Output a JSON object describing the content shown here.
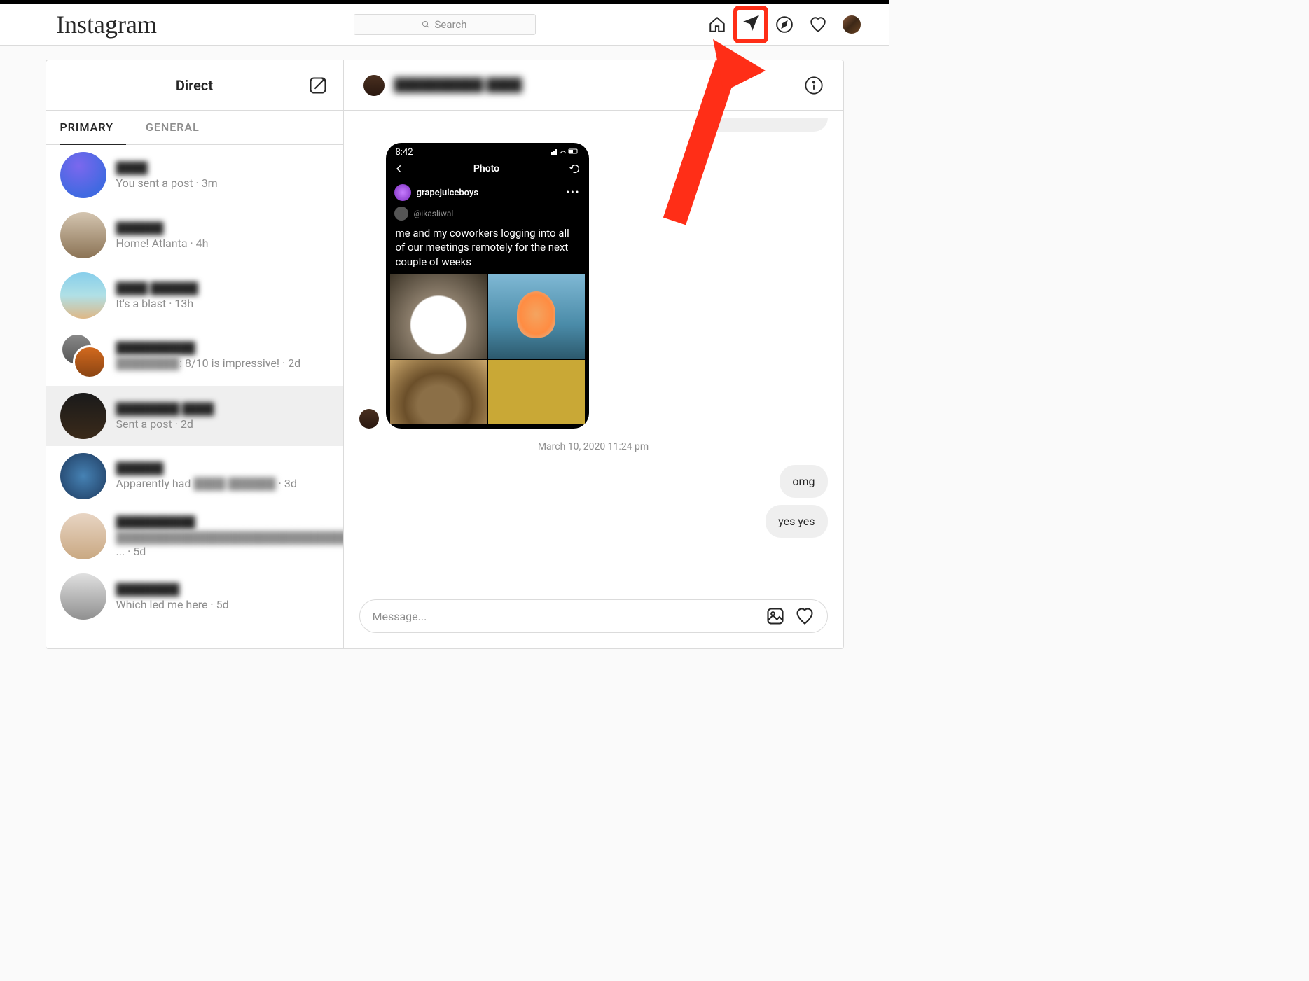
{
  "brand": "Instagram",
  "search": {
    "placeholder": "Search"
  },
  "direct": {
    "title": "Direct",
    "tabs": {
      "primary": "PRIMARY",
      "general": "GENERAL"
    },
    "conversations": [
      {
        "name": "████",
        "preview_plain": "You sent a post · 3m"
      },
      {
        "name": "██████",
        "preview_plain": "Home! Atlanta · 4h"
      },
      {
        "name": "████ ██████",
        "preview_plain": "It's a blast · 13h"
      },
      {
        "name": "██████████",
        "preview_blur": "████████",
        "preview_tail": ": 8/10 is impressive! · 2d"
      },
      {
        "name": "████████ ████",
        "preview_plain": "Sent a post · 2d"
      },
      {
        "name": "██████",
        "preview_pre": "Apparently had ",
        "preview_blur": "████ ██████",
        "preview_tail": " · 3d"
      },
      {
        "name": "██████████",
        "preview_blur": "██████████████████████████████",
        "preview_tail": "... · 5d"
      },
      {
        "name": "████████",
        "preview_plain": "Which led me here · 5d"
      }
    ]
  },
  "chat": {
    "header_name": "██████████ ████",
    "timestamp": "March 10, 2020 11:24 pm",
    "messages": {
      "omg": "omg",
      "yesyes": "yes yes"
    },
    "input_placeholder": "Message..."
  },
  "shared_post": {
    "phone_time": "8:42",
    "phone_title": "Photo",
    "post_user": "grapejuiceboys",
    "tweet_handle": "@ikasliwal",
    "tweet_text": "me and my coworkers logging into all of our meetings remotely for the next couple of weeks"
  }
}
